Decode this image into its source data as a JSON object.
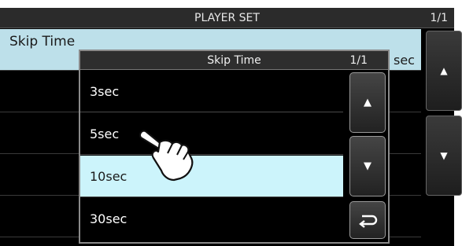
{
  "title_bar": {
    "title": "PLAYER SET",
    "page": "1/1"
  },
  "background_list": {
    "selected_item": {
      "label": "Skip Time",
      "value": "sec"
    }
  },
  "scroll_buttons": {
    "up": "▲",
    "down": "▼"
  },
  "dialog": {
    "title": "Skip Time",
    "page": "1/1",
    "options": [
      {
        "label": "3sec",
        "selected": false
      },
      {
        "label": "5sec",
        "selected": false
      },
      {
        "label": "10sec",
        "selected": true
      },
      {
        "label": "30sec",
        "selected": false
      }
    ],
    "up_glyph": "▲",
    "down_glyph": "▼"
  },
  "colors": {
    "selected_bg": "#ccf4fb",
    "list_highlight": "#bde0ea"
  },
  "icons": {
    "back": "return-arrow-icon",
    "pointer": "hand-pointer-icon"
  }
}
